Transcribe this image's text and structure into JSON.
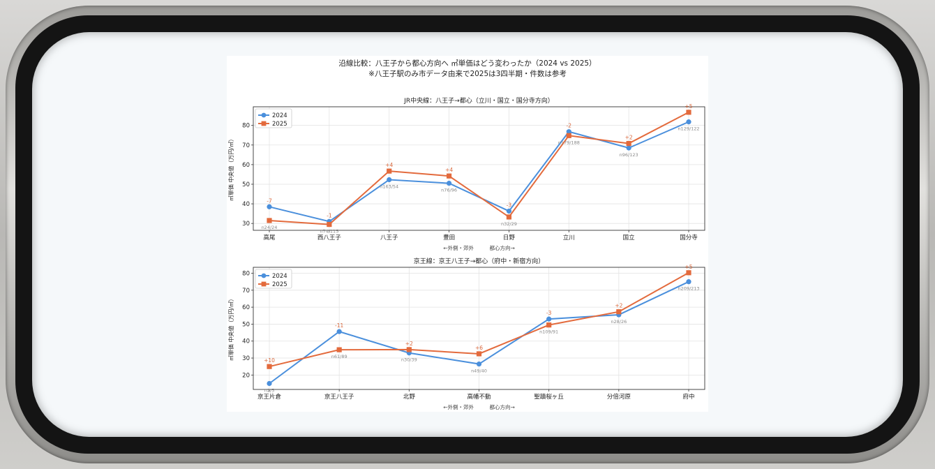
{
  "figure": {
    "title": "沿線比較：八王子から都心方向へ ㎡単価はどう変わったか（2024 vs 2025）",
    "subtitle": "※八王子駅のみ市データ由来で2025は3四半期・件数は参考"
  },
  "colors": {
    "s2024": "#4a8fdc",
    "s2025": "#e36a3c",
    "note": "#888888",
    "delta": "#d8663a"
  },
  "chart_data": [
    {
      "type": "line",
      "title": "JR中央線：八王子→都心（立川・国立・国分寺方向）",
      "xlabel": "←外側・郊外　　　都心方向→",
      "ylabel": "㎡単価 中央値（万円/㎡）",
      "ylim": [
        26.5,
        89.5
      ],
      "yticks": [
        30,
        40,
        50,
        60,
        70,
        80
      ],
      "legend": "top-left",
      "grid": true,
      "categories": [
        "高尾",
        "西八王子",
        "八王子",
        "豊田",
        "日野",
        "立川",
        "国立",
        "国分寺"
      ],
      "series": [
        {
          "name": "2024",
          "marker": "circle",
          "values": [
            38.5,
            31,
            52.3,
            50.5,
            36.3,
            76.8,
            68.5,
            81.8
          ]
        },
        {
          "name": "2025",
          "marker": "square",
          "values": [
            31.5,
            29.5,
            56.7,
            54.2,
            33.3,
            74.8,
            70.8,
            86.7
          ]
        }
      ],
      "delta_labels": [
        "-7",
        "-1",
        "+4",
        "+4",
        "-3",
        "-2",
        "+2",
        "+5"
      ],
      "count_labels": [
        "n24/24",
        "n74/115",
        "n163/54",
        "n76/96",
        "n32/29",
        "n179/188",
        "n96/123",
        "n129/122"
      ]
    },
    {
      "type": "line",
      "title": "京王線：京王八王子→都心（府中・新宿方向）",
      "xlabel": "←外側・郊外　　　都心方向→",
      "ylabel": "㎡単価 中央値（万円/㎡）",
      "ylim": [
        11.5,
        83.5
      ],
      "yticks": [
        20,
        30,
        40,
        50,
        60,
        70,
        80
      ],
      "legend": "top-left",
      "grid": true,
      "categories": [
        "京王片倉",
        "京王八王子",
        "北野",
        "高幡不動",
        "聖蹟桜ヶ丘",
        "分倍河原",
        "府中"
      ],
      "series": [
        {
          "name": "2024",
          "marker": "circle",
          "values": [
            15,
            45.6,
            33,
            26.5,
            53,
            55.5,
            75
          ]
        },
        {
          "name": "2025",
          "marker": "square",
          "values": [
            25,
            34.9,
            35,
            32.5,
            49.5,
            57.3,
            80.3
          ]
        }
      ],
      "delta_labels": [
        "+10",
        "-11",
        "+2",
        "+6",
        "-3",
        "+2",
        "+5"
      ],
      "count_labels": [
        "n2/5",
        "n61/89",
        "n30/39",
        "n49/40",
        "n109/91",
        "n28/26",
        "n209/213"
      ]
    }
  ]
}
